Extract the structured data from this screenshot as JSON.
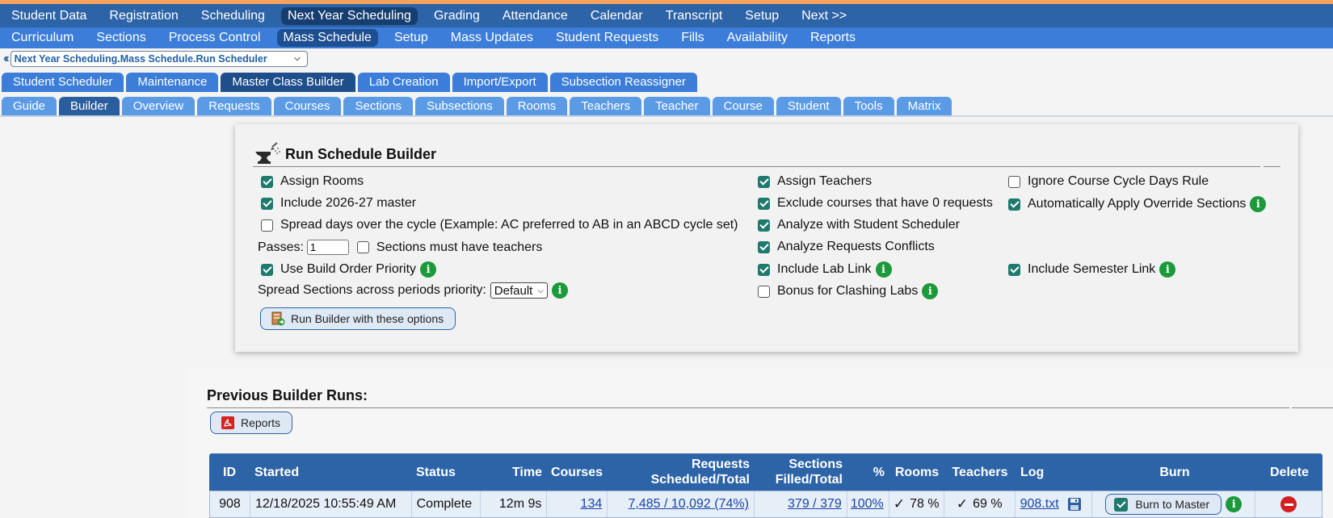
{
  "top_menu": [
    "Student Data",
    "Registration",
    "Scheduling",
    "Next Year Scheduling",
    "Grading",
    "Attendance",
    "Calendar",
    "Transcript",
    "Setup",
    "Next >>"
  ],
  "sub_menu": [
    "Curriculum",
    "Sections",
    "Process Control",
    "Mass Schedule",
    "Setup",
    "Mass Updates",
    "Student Requests",
    "Fills",
    "Availability",
    "Reports"
  ],
  "breadcrumb": {
    "selected": "Next Year Scheduling.Mass Schedule.Run Scheduler"
  },
  "tabs_row1": [
    "Student Scheduler",
    "Maintenance",
    "Master Class Builder",
    "Lab Creation",
    "Import/Export",
    "Subsection Reassigner"
  ],
  "tabs_row2": [
    "Guide",
    "Builder",
    "Overview",
    "Requests",
    "Courses",
    "Sections",
    "Subsections",
    "Rooms",
    "Teachers",
    "Teacher",
    "Course",
    "Student",
    "Tools",
    "Matrix"
  ],
  "builder": {
    "title": "Run Schedule Builder",
    "assign_rooms": "Assign Rooms",
    "include_master": "Include 2026-27 master",
    "spread_days": "Spread days over the cycle (Example: AC preferred to AB in an ABCD cycle set)",
    "passes_label": "Passes:",
    "passes_value": "1",
    "sections_teachers": "Sections must have teachers",
    "build_order": "Use Build Order Priority",
    "spread_sections_label": "Spread Sections across periods priority:",
    "spread_sections_value": "Default",
    "assign_teachers": "Assign Teachers",
    "exclude_courses": "Exclude courses that have 0 requests",
    "analyze_scheduler": "Analyze with Student Scheduler",
    "analyze_conflicts": "Analyze Requests Conflicts",
    "include_lab": "Include Lab Link",
    "bonus_labs": "Bonus for Clashing Labs",
    "ignore_cycle": "Ignore Course Cycle Days Rule",
    "auto_override": "Automatically Apply Override Sections",
    "include_semester": "Include Semester Link",
    "run_button": "Run Builder with these options"
  },
  "runs": {
    "title": "Previous Builder Runs:",
    "reports_button": "Reports",
    "headers": {
      "id": "ID",
      "started": "Started",
      "status": "Status",
      "time": "Time",
      "courses": "Courses",
      "requests_1": "Requests",
      "requests_2": "Scheduled/Total",
      "sections_1": "Sections",
      "sections_2": "Filled/Total",
      "pct": "%",
      "rooms": "Rooms",
      "teachers": "Teachers",
      "log": "Log",
      "burn": "Burn",
      "delete": "Delete"
    },
    "rows": [
      {
        "id": "908",
        "started": "12/18/2025 10:55:49 AM",
        "status": "Complete",
        "time": "12m 9s",
        "courses": "134",
        "requests": "7,485 / 10,092 (74%)",
        "sections": "379 / 379",
        "pct": "100%",
        "rooms": "78 %",
        "teachers": "69 %",
        "log": "908.txt",
        "burn": "Burn to Master"
      }
    ]
  }
}
